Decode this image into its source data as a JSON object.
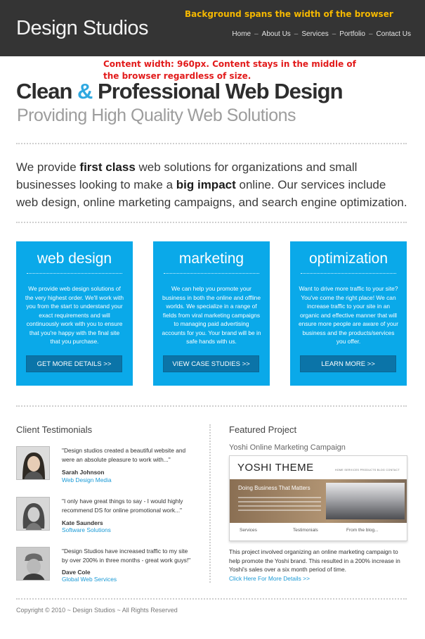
{
  "header": {
    "logo": "Design Studios",
    "annotation": "Background spans the width of the browser",
    "nav": [
      "Home",
      "About Us",
      "Services",
      "Portfolio",
      "Contact Us"
    ],
    "nav_separator": "–"
  },
  "content_annotation": "Content width: 960px. Content stays in the middle of the browser regardless of size.",
  "hero": {
    "title_part1": "Clean ",
    "title_amp": "&",
    "title_part2": " Professional Web Design",
    "subtitle": "Providing High Quality Web Solutions"
  },
  "intro": {
    "t1": "We provide ",
    "b1": "first class",
    "t2": " web solutions for organizations and small businesses looking to make a ",
    "b2": "big impact",
    "t3": " online. Our services include web design, online marketing campaigns, and search engine optimization."
  },
  "services": [
    {
      "title": "web design",
      "text": "We provide web design solutions of the very highest order. We'll work with you from the start to understand your exact requirements and will continuously work with you to ensure that you're happy with the final site that you purchase.",
      "button": "GET MORE DETAILS >>"
    },
    {
      "title": "marketing",
      "text": "We can help you promote your business in both the online and offline worlds. We specialize in a range of fields from viral marketing campaigns to managing paid advertising accounts for you. Your brand will be in safe hands with us.",
      "button": "VIEW CASE STUDIES >>"
    },
    {
      "title": "optimization",
      "text": "Want to drive more traffic to your site? You've come the right place! We can increase traffic to your site in an organic and effective manner that will ensure more people are aware of your business and the products/services you offer.",
      "button": "LEARN MORE >>"
    }
  ],
  "testimonials": {
    "title": "Client Testimonials",
    "items": [
      {
        "quote": "\"Design studios created a beautiful website and were an absolute pleasure to work with...\"",
        "name": "Sarah Johnson",
        "org": "Web Design Media"
      },
      {
        "quote": "\"I only have great things to say - I would highly recommend DS for online promotional work...\"",
        "name": "Kate Saunders",
        "org": "Software Solutions"
      },
      {
        "quote": "\"Design Studios have increased traffic to my site by over 200% in three months - great work guys!\"",
        "name": "Dave Cole",
        "org": "Global Web Services"
      }
    ]
  },
  "featured": {
    "title": "Featured Project",
    "subtitle": "Yoshi Online Marketing Campaign",
    "preview": {
      "logo": "YOSHI THEME",
      "nav": "HOME   SERVICES   PRODUCTS   BLOG   CONTACT",
      "banner_heading": "Doing Business That Matters",
      "col1": "Services",
      "col2": "Testimonials",
      "col3": "From the blog..."
    },
    "text": "This project involved organizing an online marketing campaign to help promote the Yoshi brand. This resulted in a 200% increase in Yoshi's sales over a six month period of time.",
    "link": "Click Here For More Details >>"
  },
  "footer": "Copyright © 2010 ~ Design Studios ~ All Rights Reserved"
}
